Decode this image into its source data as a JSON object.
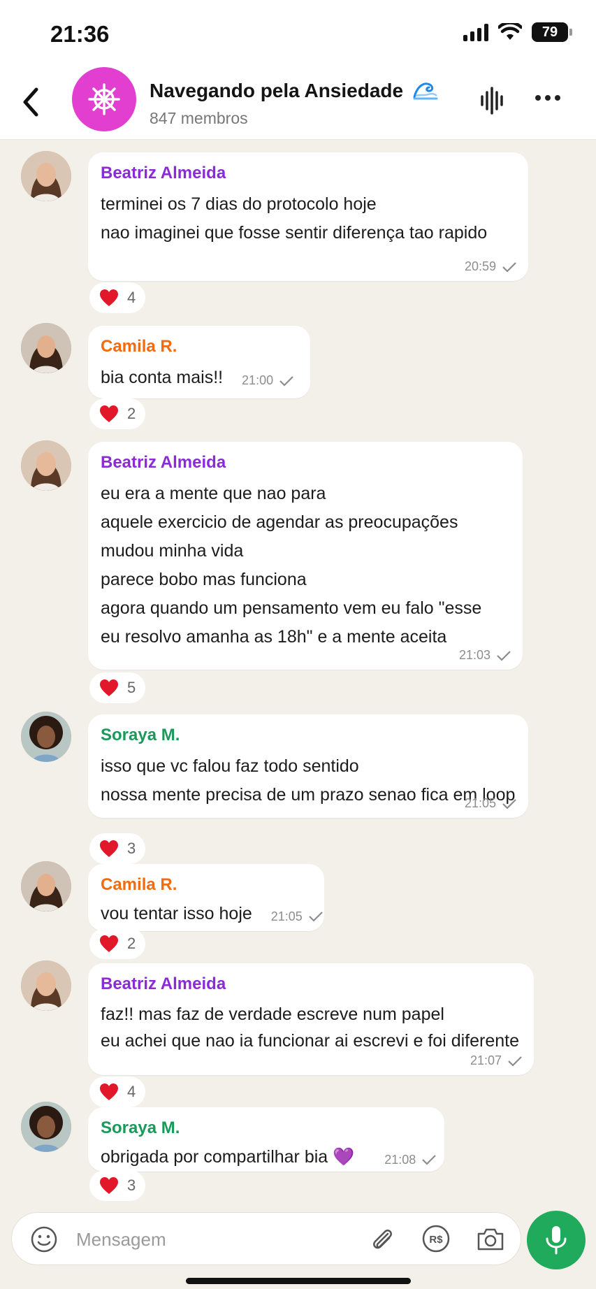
{
  "status_bar": {
    "time": "21:36",
    "battery": "79"
  },
  "header": {
    "title": "Navegando pela Ansiedade",
    "subtitle": "847 membros",
    "title_emoji_icon": "wave-icon",
    "avatar_icon": "ship-wheel-icon",
    "avatar_color": "#e23fd0"
  },
  "messages": [
    {
      "sender": "Beatriz Almeida",
      "sender_color": "#8a2bd6",
      "lines": [
        "terminei os 7 dias do protocolo hoje",
        "nao imaginei que fosse sentir diferença tao rapido"
      ],
      "time": "20:59",
      "reaction_count": "4"
    },
    {
      "sender": "Camila R.",
      "sender_color": "#ef6c12",
      "lines": [
        "bia conta mais!!"
      ],
      "time": "21:00",
      "reaction_count": "2"
    },
    {
      "sender": "Beatriz Almeida",
      "sender_color": "#8a2bd6",
      "lines": [
        "eu era a mente que nao para",
        "aquele exercicio de agendar as preocupações",
        "mudou minha vida",
        "parece bobo mas funciona",
        "agora quando um pensamento vem eu falo \"esse",
        "eu resolvo amanha as 18h\" e a mente aceita"
      ],
      "time": "21:03",
      "reaction_count": "5"
    },
    {
      "sender": "Soraya M.",
      "sender_color": "#199a5a",
      "lines": [
        "isso que vc falou faz todo sentido",
        "nossa mente precisa de um prazo senao fica em loop"
      ],
      "time": "21:05",
      "reaction_count": "3"
    },
    {
      "sender": "Camila R.",
      "sender_color": "#ef6c12",
      "lines": [
        "vou tentar isso hoje"
      ],
      "time": "21:05",
      "reaction_count": "2"
    },
    {
      "sender": "Beatriz Almeida",
      "sender_color": "#8a2bd6",
      "lines": [
        "faz!! mas faz de verdade escreve num papel",
        "eu achei que nao ia funcionar ai escrevi e foi diferente"
      ],
      "time": "21:07",
      "reaction_count": "4"
    },
    {
      "sender": "Soraya M.",
      "sender_color": "#199a5a",
      "lines": [
        "obrigada por compartilhar bia 💜"
      ],
      "time": "21:08",
      "reaction_count": "3"
    }
  ],
  "composer": {
    "placeholder": "Mensagem",
    "payment_label": "R$"
  },
  "colors": {
    "mic_button": "#1faa5c",
    "background": "#f3efe9"
  }
}
